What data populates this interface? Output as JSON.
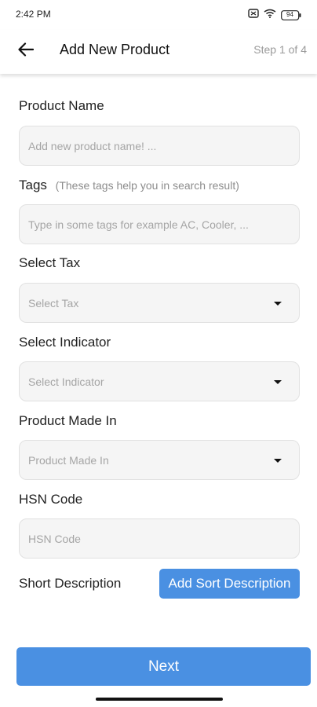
{
  "status_bar": {
    "time": "2:42 PM",
    "battery": "94",
    "icons": [
      "screen-record-icon",
      "wifi-icon",
      "battery-icon"
    ]
  },
  "header": {
    "title": "Add New Product",
    "step": "Step 1 of 4",
    "back_icon": "back-arrow-icon"
  },
  "form": {
    "product_name": {
      "label": "Product Name",
      "placeholder": "Add new product name! ..."
    },
    "tags": {
      "label": "Tags",
      "hint": "(These tags help you in search result)",
      "placeholder": "Type in some tags for example AC, Cooler, ..."
    },
    "tax": {
      "label": "Select Tax",
      "value": "Select Tax"
    },
    "indicator": {
      "label": "Select Indicator",
      "value": "Select Indicator"
    },
    "made_in": {
      "label": "Product Made In",
      "value": "Product Made In"
    },
    "hsn": {
      "label": "HSN Code",
      "placeholder": "HSN Code"
    },
    "short_description": {
      "label": "Short Description",
      "button": "Add Sort Description"
    }
  },
  "footer": {
    "next": "Next"
  },
  "colors": {
    "accent": "#4a90e2",
    "field_bg": "#f5f5f5",
    "muted": "#9a9a9a"
  }
}
